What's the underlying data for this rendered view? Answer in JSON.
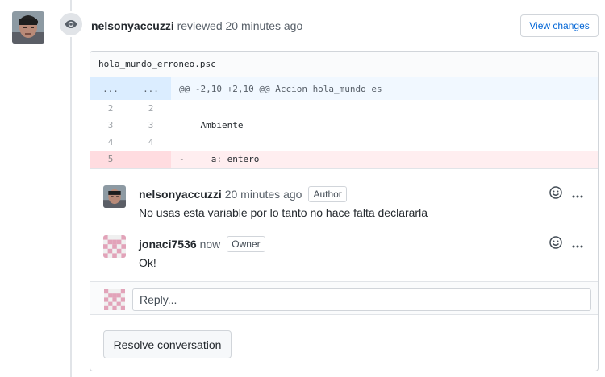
{
  "review": {
    "author": "nelsonyaccuzzi",
    "action_text": "reviewed 20 minutes ago",
    "view_changes_label": "View changes"
  },
  "file": {
    "name": "hola_mundo_erroneo.psc"
  },
  "diff": {
    "hunk": {
      "left": "...",
      "right": "...",
      "text": "@@ -2,10 +2,10 @@ Accion hola_mundo es"
    },
    "rows": [
      {
        "left": "2",
        "right": "2",
        "text": ""
      },
      {
        "left": "3",
        "right": "3",
        "text": "    Ambiente"
      },
      {
        "left": "4",
        "right": "4",
        "text": ""
      },
      {
        "left": "5",
        "right": "",
        "text": "-     a: entero"
      }
    ]
  },
  "comments": [
    {
      "author": "nelsonyaccuzzi",
      "time": "20 minutes ago",
      "badge": "Author",
      "body": "No usas esta variable por lo tanto no hace falta declararla"
    },
    {
      "author": "jonaci7536",
      "time": "now",
      "badge": "Owner",
      "body": "Ok!"
    }
  ],
  "reply": {
    "placeholder": "Reply..."
  },
  "resolve": {
    "label": "Resolve conversation"
  },
  "colors": {
    "link": "#0366d6",
    "hunk_bg": "#f1f8ff",
    "deletion_bg": "#ffeef0",
    "identicon": "#e2a3b9"
  }
}
